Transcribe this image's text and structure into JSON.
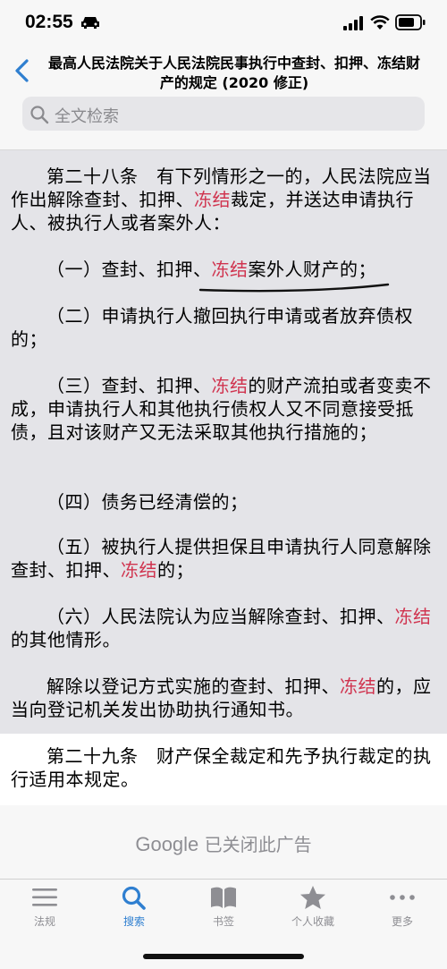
{
  "status": {
    "time": "02:55"
  },
  "header": {
    "title": "最高人民法院关于人民法院民事执行中查封、扣押、冻结财产的规定 (2020 修正)"
  },
  "search": {
    "placeholder": "全文检索"
  },
  "article": {
    "intro_pre": "第二十八条　有下列情形之一的，人民法院应当作出解除查封、扣押、",
    "intro_hl": "冻结",
    "intro_post": "裁定，并送达申请执行人、被执行人或者案外人：",
    "item1_pre": "（一）查封、扣押、",
    "item1_hl": "冻结",
    "item1_post": "案外人财产的；",
    "item2": "（二）申请执行人撤回执行申请或者放弃债权的；",
    "item3_pre": "（三）查封、扣押、",
    "item3_hl": "冻结",
    "item3_post": "的财产流拍或者变卖不成，申请执行人和其他执行债权人又不同意接受抵债，且对该财产又无法采取其他执行措施的；",
    "item4": "（四）债务已经清偿的；",
    "item5_pre": "（五）被执行人提供担保且申请执行人同意解除查封、扣押、",
    "item5_hl": "冻结",
    "item5_post": "的；",
    "item6_pre": "（六）人民法院认为应当解除查封、扣押、",
    "item6_hl": "冻结",
    "item6_post": "的其他情形。",
    "closing_pre": "解除以登记方式实施的查封、扣押、",
    "closing_hl": "冻结",
    "closing_post": "的，应当向登记机关发出协助执行通知书。"
  },
  "next_article": "第二十九条　财产保全裁定和先予执行裁定的执行适用本规定。",
  "ad": {
    "brand": "Google",
    "text": "已关闭此广告"
  },
  "tabs": [
    {
      "label": "法规",
      "icon": "list-icon"
    },
    {
      "label": "搜索",
      "icon": "search-icon"
    },
    {
      "label": "书签",
      "icon": "book-icon"
    },
    {
      "label": "个人收藏",
      "icon": "star-icon"
    },
    {
      "label": "更多",
      "icon": "more-icon"
    }
  ],
  "colors": {
    "accent": "#2f7fd0",
    "highlight": "#d0344f",
    "content_bg": "#e4e4e8"
  }
}
